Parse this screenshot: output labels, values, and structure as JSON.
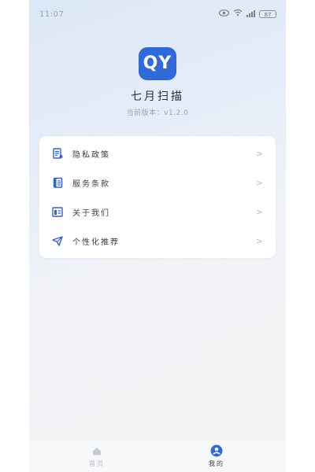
{
  "status_bar": {
    "time": "11:07",
    "battery": "87"
  },
  "app": {
    "logo_text": "QY",
    "name": "七月扫描",
    "version": "当前版本：v1.2.0"
  },
  "menu": {
    "items": [
      {
        "label": "隐私政策",
        "icon": "document-list-icon"
      },
      {
        "label": "服务条款",
        "icon": "clipboard-icon"
      },
      {
        "label": "关于我们",
        "icon": "info-panel-icon"
      },
      {
        "label": "个性化推荐",
        "icon": "paper-plane-icon"
      }
    ],
    "chevron": ">"
  },
  "tab_bar": {
    "tabs": [
      {
        "label": "首页",
        "icon": "home-icon",
        "active": false
      },
      {
        "label": "我的",
        "icon": "user-icon",
        "active": true
      }
    ]
  },
  "colors": {
    "accent": "#2f6ad8",
    "icon_color": "#3560c9",
    "inactive_tab": "#b3b9c2"
  }
}
